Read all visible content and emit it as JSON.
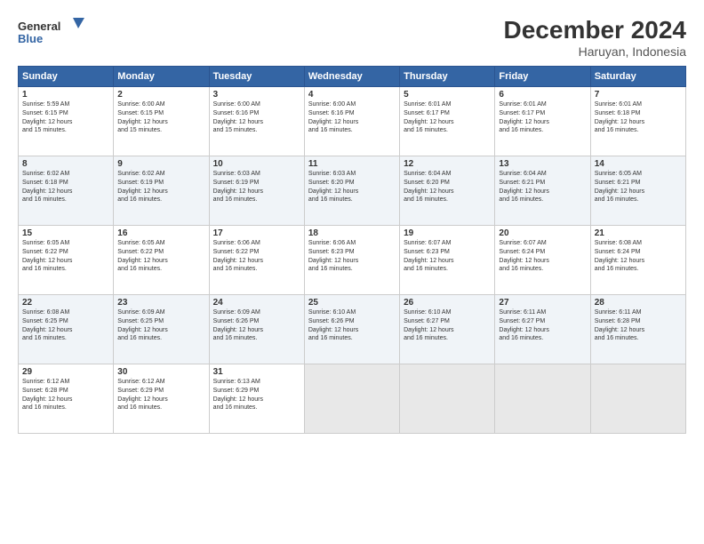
{
  "header": {
    "logo_line1": "General",
    "logo_line2": "Blue",
    "month": "December 2024",
    "location": "Haruyan, Indonesia"
  },
  "days_of_week": [
    "Sunday",
    "Monday",
    "Tuesday",
    "Wednesday",
    "Thursday",
    "Friday",
    "Saturday"
  ],
  "weeks": [
    [
      {
        "day": "1",
        "sunrise": "5:59 AM",
        "sunset": "6:15 PM",
        "daylight": "12 hours and 15 minutes."
      },
      {
        "day": "2",
        "sunrise": "6:00 AM",
        "sunset": "6:15 PM",
        "daylight": "12 hours and 15 minutes."
      },
      {
        "day": "3",
        "sunrise": "6:00 AM",
        "sunset": "6:16 PM",
        "daylight": "12 hours and 15 minutes."
      },
      {
        "day": "4",
        "sunrise": "6:00 AM",
        "sunset": "6:16 PM",
        "daylight": "12 hours and 16 minutes."
      },
      {
        "day": "5",
        "sunrise": "6:01 AM",
        "sunset": "6:17 PM",
        "daylight": "12 hours and 16 minutes."
      },
      {
        "day": "6",
        "sunrise": "6:01 AM",
        "sunset": "6:17 PM",
        "daylight": "12 hours and 16 minutes."
      },
      {
        "day": "7",
        "sunrise": "6:01 AM",
        "sunset": "6:18 PM",
        "daylight": "12 hours and 16 minutes."
      }
    ],
    [
      {
        "day": "8",
        "sunrise": "6:02 AM",
        "sunset": "6:18 PM",
        "daylight": "12 hours and 16 minutes."
      },
      {
        "day": "9",
        "sunrise": "6:02 AM",
        "sunset": "6:19 PM",
        "daylight": "12 hours and 16 minutes."
      },
      {
        "day": "10",
        "sunrise": "6:03 AM",
        "sunset": "6:19 PM",
        "daylight": "12 hours and 16 minutes."
      },
      {
        "day": "11",
        "sunrise": "6:03 AM",
        "sunset": "6:20 PM",
        "daylight": "12 hours and 16 minutes."
      },
      {
        "day": "12",
        "sunrise": "6:04 AM",
        "sunset": "6:20 PM",
        "daylight": "12 hours and 16 minutes."
      },
      {
        "day": "13",
        "sunrise": "6:04 AM",
        "sunset": "6:21 PM",
        "daylight": "12 hours and 16 minutes."
      },
      {
        "day": "14",
        "sunrise": "6:05 AM",
        "sunset": "6:21 PM",
        "daylight": "12 hours and 16 minutes."
      }
    ],
    [
      {
        "day": "15",
        "sunrise": "6:05 AM",
        "sunset": "6:22 PM",
        "daylight": "12 hours and 16 minutes."
      },
      {
        "day": "16",
        "sunrise": "6:05 AM",
        "sunset": "6:22 PM",
        "daylight": "12 hours and 16 minutes."
      },
      {
        "day": "17",
        "sunrise": "6:06 AM",
        "sunset": "6:22 PM",
        "daylight": "12 hours and 16 minutes."
      },
      {
        "day": "18",
        "sunrise": "6:06 AM",
        "sunset": "6:23 PM",
        "daylight": "12 hours and 16 minutes."
      },
      {
        "day": "19",
        "sunrise": "6:07 AM",
        "sunset": "6:23 PM",
        "daylight": "12 hours and 16 minutes."
      },
      {
        "day": "20",
        "sunrise": "6:07 AM",
        "sunset": "6:24 PM",
        "daylight": "12 hours and 16 minutes."
      },
      {
        "day": "21",
        "sunrise": "6:08 AM",
        "sunset": "6:24 PM",
        "daylight": "12 hours and 16 minutes."
      }
    ],
    [
      {
        "day": "22",
        "sunrise": "6:08 AM",
        "sunset": "6:25 PM",
        "daylight": "12 hours and 16 minutes."
      },
      {
        "day": "23",
        "sunrise": "6:09 AM",
        "sunset": "6:25 PM",
        "daylight": "12 hours and 16 minutes."
      },
      {
        "day": "24",
        "sunrise": "6:09 AM",
        "sunset": "6:26 PM",
        "daylight": "12 hours and 16 minutes."
      },
      {
        "day": "25",
        "sunrise": "6:10 AM",
        "sunset": "6:26 PM",
        "daylight": "12 hours and 16 minutes."
      },
      {
        "day": "26",
        "sunrise": "6:10 AM",
        "sunset": "6:27 PM",
        "daylight": "12 hours and 16 minutes."
      },
      {
        "day": "27",
        "sunrise": "6:11 AM",
        "sunset": "6:27 PM",
        "daylight": "12 hours and 16 minutes."
      },
      {
        "day": "28",
        "sunrise": "6:11 AM",
        "sunset": "6:28 PM",
        "daylight": "12 hours and 16 minutes."
      }
    ],
    [
      {
        "day": "29",
        "sunrise": "6:12 AM",
        "sunset": "6:28 PM",
        "daylight": "12 hours and 16 minutes."
      },
      {
        "day": "30",
        "sunrise": "6:12 AM",
        "sunset": "6:29 PM",
        "daylight": "12 hours and 16 minutes."
      },
      {
        "day": "31",
        "sunrise": "6:13 AM",
        "sunset": "6:29 PM",
        "daylight": "12 hours and 16 minutes."
      },
      null,
      null,
      null,
      null
    ]
  ],
  "labels": {
    "sunrise": "Sunrise:",
    "sunset": "Sunset:",
    "daylight": "Daylight:"
  }
}
